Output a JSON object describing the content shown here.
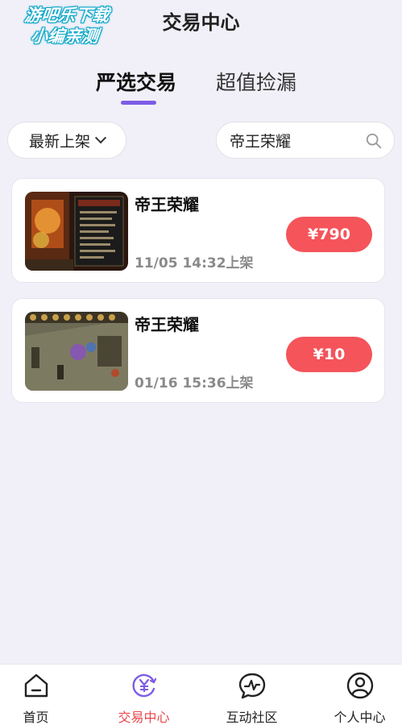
{
  "watermark": {
    "line1": "游吧乐下载",
    "line2": "小编亲测"
  },
  "header": {
    "title": "交易中心"
  },
  "tabs": [
    {
      "label": "严选交易",
      "active": true
    },
    {
      "label": "超值捡漏",
      "active": false
    }
  ],
  "filters": {
    "sort_label": "最新上架",
    "search_value": "帝王荣耀"
  },
  "listings": [
    {
      "title": "帝王荣耀",
      "date": "11/05 14:32上架",
      "price": "¥790"
    },
    {
      "title": "帝王荣耀",
      "date": "01/16 15:36上架",
      "price": "¥10"
    }
  ],
  "bottom_nav": [
    {
      "label": "首页",
      "icon": "home-icon",
      "active": false
    },
    {
      "label": "交易中心",
      "icon": "yen-exchange-icon",
      "active": true
    },
    {
      "label": "互动社区",
      "icon": "chat-pulse-icon",
      "active": false
    },
    {
      "label": "个人中心",
      "icon": "user-icon",
      "active": false
    }
  ],
  "colors": {
    "accent": "#7d5ce6",
    "price": "#f4545a",
    "nav_active": "#e9464e",
    "background": "#f1f0f8"
  }
}
